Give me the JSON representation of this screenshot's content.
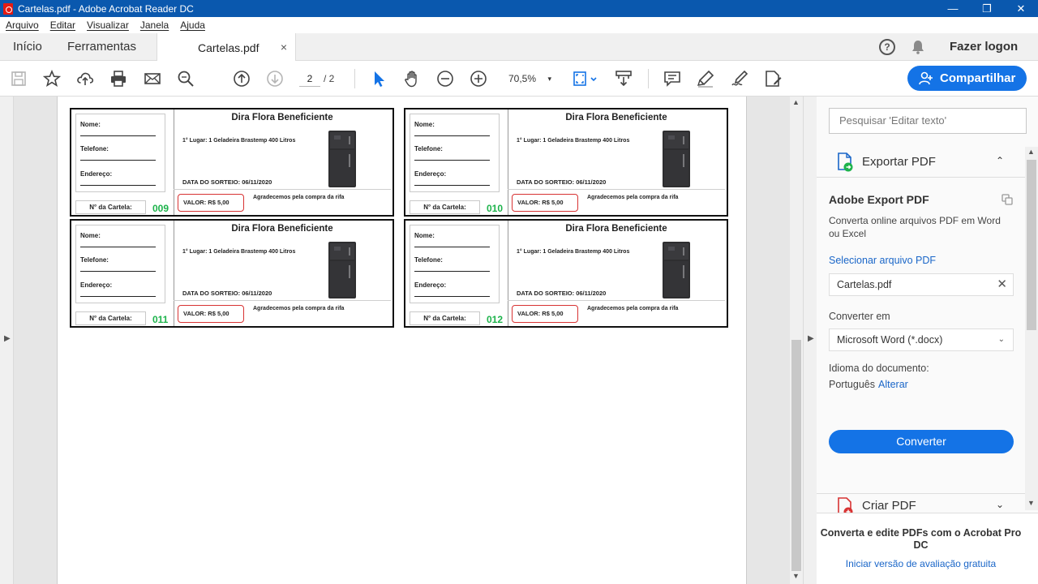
{
  "window": {
    "title": "Cartelas.pdf - Adobe Acrobat Reader DC",
    "minimize": "—",
    "restore": "❐",
    "close": "✕"
  },
  "menu": [
    "Arquivo",
    "Editar",
    "Visualizar",
    "Janela",
    "Ajuda"
  ],
  "tabs": {
    "home": "Início",
    "tools": "Ferramentas",
    "document": "Cartelas.pdf",
    "close": "×",
    "help": "?",
    "login": "Fazer logon"
  },
  "toolbar": {
    "icons": [
      "save-icon",
      "star-icon",
      "upload-icon",
      "print-icon",
      "email-icon",
      "search-icon",
      "page-up-icon",
      "page-down-icon",
      "select-arrow-icon",
      "hand-icon",
      "zoom-out-icon",
      "zoom-in-icon",
      "fit-page-icon",
      "scroll-mode-icon",
      "comment-icon",
      "highlight-icon",
      "sign-icon",
      "fill-sign-icon"
    ],
    "current_page": "2",
    "total_pages": "/ 2",
    "zoom": "70,5%",
    "zoom_caret": "▾",
    "share_label": "Compartilhar"
  },
  "cards": [
    {
      "title": "Dira Flora Beneficiente",
      "name_label": "Nome:",
      "phone_label": "Telefone:",
      "address_label": "Endereço:",
      "prize": "1° Lugar: 1 Geladeira Brastemp 400 Litros",
      "draw_date": "DATA DO SORTEIO: 06/11/2020",
      "card_label": "N° da Cartela:",
      "number": "009",
      "price": "VALOR: R$ 5,00",
      "thanks": "Agradecemos pela compra da rifa"
    },
    {
      "title": "Dira Flora Beneficiente",
      "name_label": "Nome:",
      "phone_label": "Telefone:",
      "address_label": "Endereço:",
      "prize": "1° Lugar: 1 Geladeira Brastemp 400 Litros",
      "draw_date": "DATA DO SORTEIO: 06/11/2020",
      "card_label": "N° da Cartela:",
      "number": "010",
      "price": "VALOR: R$ 5,00",
      "thanks": "Agradecemos pela compra da rifa"
    },
    {
      "title": "Dira Flora Beneficiente",
      "name_label": "Nome:",
      "phone_label": "Telefone:",
      "address_label": "Endereço:",
      "prize": "1° Lugar: 1 Geladeira Brastemp 400 Litros",
      "draw_date": "DATA DO SORTEIO: 06/11/2020",
      "card_label": "N° da Cartela:",
      "number": "011",
      "price": "VALOR: R$ 5,00",
      "thanks": "Agradecemos pela compra da rifa"
    },
    {
      "title": "Dira Flora Beneficiente",
      "name_label": "Nome:",
      "phone_label": "Telefone:",
      "address_label": "Endereço:",
      "prize": "1° Lugar: 1 Geladeira Brastemp 400 Litros",
      "draw_date": "DATA DO SORTEIO: 06/11/2020",
      "card_label": "N° da Cartela:",
      "number": "012",
      "price": "VALOR: R$ 5,00",
      "thanks": "Agradecemos pela compra da rifa"
    }
  ],
  "panel": {
    "search_placeholder": "Pesquisar 'Editar texto'",
    "export_title": "Exportar PDF",
    "export_chevron": "⌃",
    "ae_title": "Adobe Export PDF",
    "ae_desc": "Converta online arquivos PDF em Word ou Excel",
    "select_file": "Selecionar arquivo PDF",
    "file_name": "Cartelas.pdf",
    "file_clear": "✕",
    "convert_to_label": "Converter em",
    "convert_to_value": "Microsoft Word (*.docx)",
    "convert_caret": "⌄",
    "lang_label": "Idioma do documento:",
    "lang_value": "Português",
    "lang_change": "Alterar",
    "convert_button": "Converter",
    "create_title": "Criar PDF",
    "create_chevron": "⌄",
    "promo_text": "Converta e edite PDFs com o Acrobat Pro DC",
    "promo_link": "Iniciar versão de avaliação gratuita"
  },
  "colors": {
    "titlebar": "#0a58ae",
    "accent": "#1473e6",
    "card_number": "#1db34b",
    "price_border": "#d83333"
  }
}
